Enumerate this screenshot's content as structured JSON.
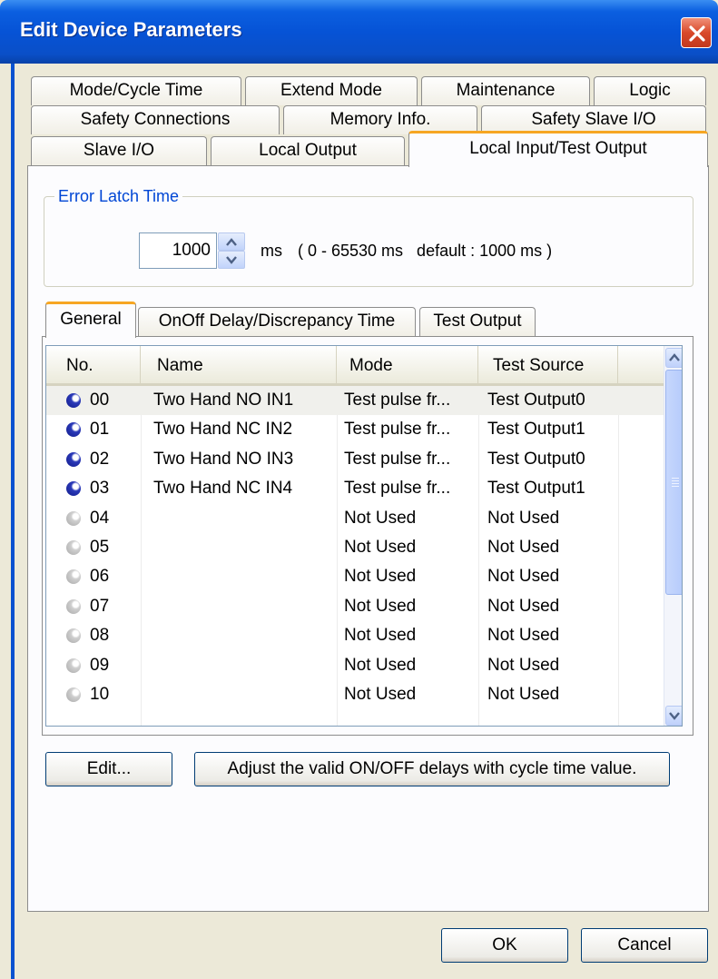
{
  "window": {
    "title": "Edit Device Parameters"
  },
  "tabs": [
    "Mode/Cycle Time",
    "Extend Mode",
    "Maintenance",
    "Logic",
    "Safety Connections",
    "Memory Info.",
    "Safety Slave I/O",
    "Slave I/O",
    "Local Output",
    "Local Input/Test Output"
  ],
  "error_latch": {
    "label": "Error Latch Time",
    "value": "1000",
    "unit": "ms",
    "range": "( 0 - 65530 ms   default : 1000 ms )"
  },
  "inner_tabs": [
    "General",
    "OnOff Delay/Discrepancy Time",
    "Test Output"
  ],
  "table": {
    "columns": [
      "No.",
      "Name",
      "Mode",
      "Test Source"
    ],
    "rows": [
      {
        "no": "00",
        "name": "Two Hand NO IN1",
        "mode": "Test pulse fr...",
        "source": "Test Output0",
        "used": true
      },
      {
        "no": "01",
        "name": "Two Hand NC IN2",
        "mode": "Test pulse fr...",
        "source": "Test Output1",
        "used": true
      },
      {
        "no": "02",
        "name": "Two Hand NO IN3",
        "mode": "Test pulse fr...",
        "source": "Test Output0",
        "used": true
      },
      {
        "no": "03",
        "name": "Two Hand NC IN4",
        "mode": "Test pulse fr...",
        "source": "Test Output1",
        "used": true
      },
      {
        "no": "04",
        "name": "",
        "mode": "Not Used",
        "source": "Not Used",
        "used": false
      },
      {
        "no": "05",
        "name": "",
        "mode": "Not Used",
        "source": "Not Used",
        "used": false
      },
      {
        "no": "06",
        "name": "",
        "mode": "Not Used",
        "source": "Not Used",
        "used": false
      },
      {
        "no": "07",
        "name": "",
        "mode": "Not Used",
        "source": "Not Used",
        "used": false
      },
      {
        "no": "08",
        "name": "",
        "mode": "Not Used",
        "source": "Not Used",
        "used": false
      },
      {
        "no": "09",
        "name": "",
        "mode": "Not Used",
        "source": "Not Used",
        "used": false
      },
      {
        "no": "10",
        "name": "",
        "mode": "Not Used",
        "source": "Not Used",
        "used": false
      }
    ]
  },
  "buttons": {
    "edit": "Edit...",
    "adjust": "Adjust the valid ON/OFF delays with cycle time value.",
    "ok": "OK",
    "cancel": "Cancel"
  },
  "icons": {
    "close": "close-icon",
    "spin_up": "spin-up-icon",
    "spin_down": "spin-down-icon",
    "status_used": "status-dot-blue",
    "status_unused": "status-dot-gray"
  },
  "colors": {
    "titlebar": "#0653d6",
    "active_tab_accent": "#f6a623",
    "group_label": "#0046d5",
    "dot_used": "#1b2a9e",
    "dot_unused": "#b8b8b8"
  }
}
